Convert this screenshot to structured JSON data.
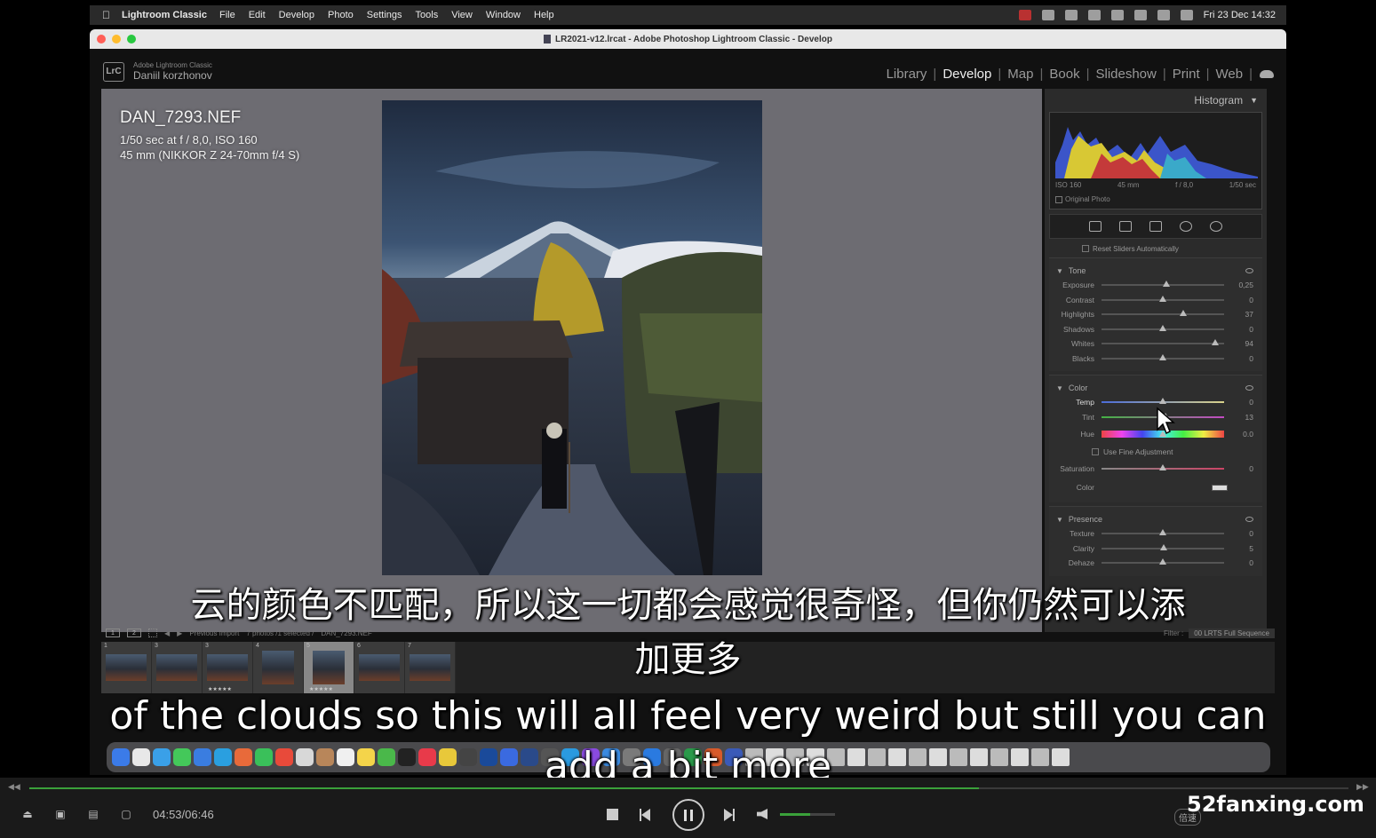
{
  "menubar": {
    "app_name": "Lightroom Classic",
    "items": [
      "File",
      "Edit",
      "Develop",
      "Photo",
      "Settings",
      "Tools",
      "View",
      "Window",
      "Help"
    ],
    "datetime": "Fri 23 Dec  14:32"
  },
  "window": {
    "title": "LR2021-v12.lrcat - Adobe Photoshop Lightroom Classic - Develop"
  },
  "identity": {
    "logo": "LrC",
    "product": "Adobe Lightroom Classic",
    "user": "Daniil korzhonov"
  },
  "modules": [
    "Library",
    "Develop",
    "Map",
    "Book",
    "Slideshow",
    "Print",
    "Web"
  ],
  "active_module": "Develop",
  "photo_info": {
    "filename": "DAN_7293.NEF",
    "exposure": "1/50 sec at f / 8,0, ISO 160",
    "lens": "45 mm (NIKKOR Z 24-70mm f/4 S)"
  },
  "histogram": {
    "title": "Histogram",
    "iso": "ISO 160",
    "focal": "45 mm",
    "aperture": "f / 8,0",
    "shutter": "1/50 sec",
    "original_photo": "Original Photo"
  },
  "reset_sliders": "Reset Sliders Automatically",
  "tone": {
    "title": "Tone",
    "sliders": [
      {
        "label": "Exposure",
        "value": "0,25",
        "pos": 0.53
      },
      {
        "label": "Contrast",
        "value": "0",
        "pos": 0.5
      },
      {
        "label": "Highlights",
        "value": "37",
        "pos": 0.67
      },
      {
        "label": "Shadows",
        "value": "0",
        "pos": 0.5
      },
      {
        "label": "Whites",
        "value": "94",
        "pos": 0.93
      },
      {
        "label": "Blacks",
        "value": "0",
        "pos": 0.5
      }
    ]
  },
  "color": {
    "title": "Color",
    "temp": {
      "label": "Temp",
      "value": "0",
      "pos": 0.5
    },
    "tint": {
      "label": "Tint",
      "value": "13",
      "pos": 0.52
    },
    "hue": {
      "label": "Hue",
      "value": "0.0",
      "pos": 0.5
    },
    "fine": "Use Fine Adjustment",
    "saturation": {
      "label": "Saturation",
      "value": "0",
      "pos": 0.5
    },
    "color_label": "Color"
  },
  "presence": {
    "title": "Presence",
    "sliders": [
      {
        "label": "Texture",
        "value": "0",
        "pos": 0.5
      },
      {
        "label": "Clarity",
        "value": "5",
        "pos": 0.51
      },
      {
        "label": "Dehaze",
        "value": "0",
        "pos": 0.5
      }
    ]
  },
  "filmstrip": {
    "page1": "1",
    "page2": "2",
    "source": "Previous Import",
    "count": "7 photos /1 selected /",
    "current": "DAN_7293.NEF",
    "filter_label": "Filter :",
    "filter_value": "00 LRTS Full Sequence",
    "thumbs": [
      {
        "num": "1",
        "stars": ""
      },
      {
        "num": "3",
        "stars": ""
      },
      {
        "num": "3",
        "stars": "★★★★★"
      },
      {
        "num": "4",
        "stars": ""
      },
      {
        "num": "5",
        "stars": "★★★★★"
      },
      {
        "num": "6",
        "stars": ""
      },
      {
        "num": "7",
        "stars": ""
      }
    ]
  },
  "subtitles": {
    "cn_line1": "云的颜色不匹配，所以这一切都会感觉很奇怪，但你仍然可以添",
    "cn_line2": "加更多",
    "en_line1": "of the clouds so this will all feel very weird but still you can",
    "en_line2": "add a bit more"
  },
  "player": {
    "time": "04:53/06:46",
    "progress": 0.72,
    "volume": 0.55,
    "speed": "倍速",
    "watermark": "52fanxing.com"
  }
}
